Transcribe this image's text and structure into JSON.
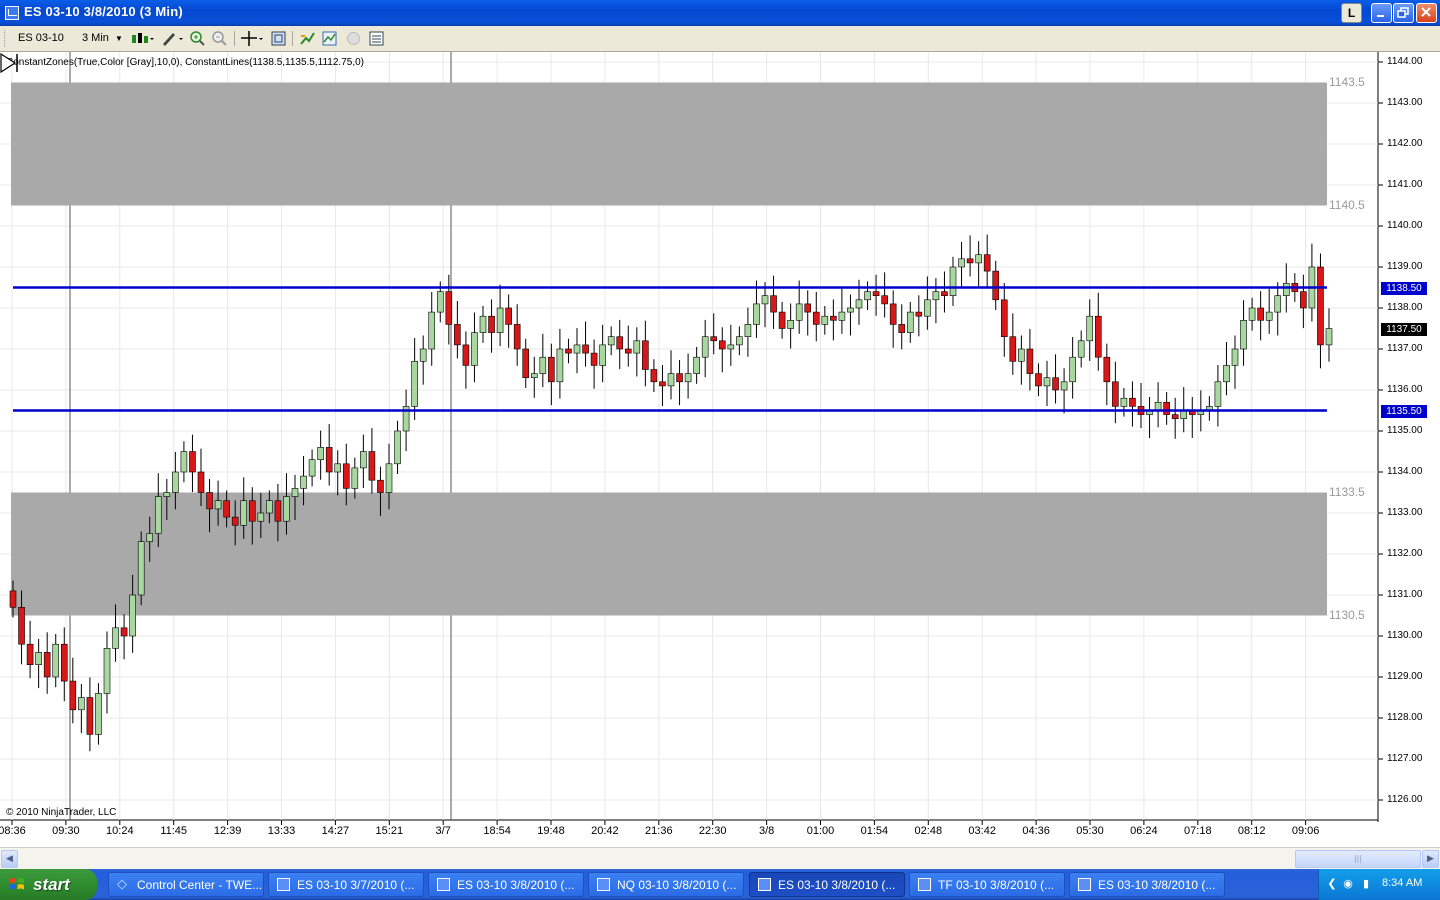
{
  "window": {
    "title": "ES 03-10  3/8/2010 (3 Min)",
    "buttons": {
      "link": "L",
      "minimize": "_",
      "maximize": "□",
      "close": "×"
    }
  },
  "toolbar": {
    "instrument": "ES 03-10",
    "interval": "3 Min",
    "icons": [
      "bar-style-icon",
      "drawing-tools-icon",
      "zoom-in-icon",
      "zoom-out-icon",
      "crosshair-icon",
      "data-box-icon",
      "strategies-icon",
      "indicators-icon",
      "chart-trader-icon",
      "properties-icon"
    ]
  },
  "chart": {
    "indicator_label": "ConstantZones(True,Color [Gray],10,0), ConstantLines(1138.5,1135.5,1112.75,0)",
    "copyright": "© 2010 NinjaTrader, LLC",
    "zone_labels": [
      "1143.5",
      "1140.5",
      "1133.5",
      "1130.5"
    ],
    "price_boxes": [
      {
        "label": "1138.50",
        "color": "#0000cc"
      },
      {
        "label": "1137.50",
        "color": "#000000"
      },
      {
        "label": "1135.50",
        "color": "#0000cc"
      }
    ],
    "colors": {
      "up_bar": "#a8d8a0",
      "down_bar": "#d81818",
      "zone": "#a9a9a9",
      "line": "#0000cc"
    }
  },
  "chart_data": {
    "type": "candlestick",
    "instrument": "ES 03-10",
    "interval": "3 Min",
    "y_axis": {
      "range": [
        1126.0,
        1144.0
      ],
      "ticks": [
        "1144.00",
        "1143.00",
        "1142.00",
        "1141.00",
        "1140.00",
        "1139.00",
        "1138.00",
        "1137.00",
        "1136.00",
        "1135.00",
        "1134.00",
        "1133.00",
        "1132.00",
        "1131.00",
        "1130.00",
        "1129.00",
        "1128.00",
        "1127.00",
        "1126.00"
      ]
    },
    "x_axis": {
      "ticks": [
        "08:36",
        "09:30",
        "10:24",
        "11:45",
        "12:39",
        "13:33",
        "14:27",
        "15:21",
        "3/7",
        "18:54",
        "19:48",
        "20:42",
        "21:36",
        "22:30",
        "3/8",
        "01:00",
        "01:54",
        "02:48",
        "03:42",
        "04:36",
        "05:30",
        "06:24",
        "07:18",
        "08:12",
        "09:06"
      ]
    },
    "zones": [
      {
        "from": 1140.5,
        "to": 1143.5,
        "color": "Gray"
      },
      {
        "from": 1130.5,
        "to": 1133.5,
        "color": "Gray"
      }
    ],
    "constant_lines": [
      1138.5,
      1135.5
    ],
    "last_price": 1137.5,
    "grid": true,
    "closes": [
      1130.7,
      1129.8,
      1129.3,
      1129.6,
      1129.0,
      1129.8,
      1128.9,
      1128.2,
      1128.5,
      1127.6,
      1128.6,
      1129.7,
      1130.2,
      1130.0,
      1131.0,
      1132.3,
      1132.5,
      1133.4,
      1133.5,
      1134.0,
      1134.5,
      1134.0,
      1133.5,
      1133.1,
      1133.3,
      1132.9,
      1132.7,
      1133.3,
      1132.8,
      1133.0,
      1133.3,
      1132.8,
      1133.4,
      1133.6,
      1133.9,
      1134.3,
      1134.6,
      1134.0,
      1134.2,
      1133.6,
      1134.1,
      1134.5,
      1133.8,
      1133.5,
      1134.2,
      1135.0,
      1135.6,
      1136.7,
      1137.0,
      1137.9,
      1138.4,
      1137.6,
      1137.1,
      1136.6,
      1137.4,
      1137.8,
      1137.4,
      1138.0,
      1137.6,
      1137.0,
      1136.3,
      1136.4,
      1136.8,
      1136.2,
      1137.0,
      1136.9,
      1137.1,
      1136.9,
      1136.6,
      1137.1,
      1137.3,
      1137.0,
      1136.9,
      1137.2,
      1136.5,
      1136.2,
      1136.1,
      1136.4,
      1136.2,
      1136.4,
      1136.8,
      1137.3,
      1137.2,
      1137.0,
      1137.1,
      1137.3,
      1137.6,
      1138.1,
      1138.3,
      1137.9,
      1137.5,
      1137.7,
      1138.1,
      1137.9,
      1137.6,
      1137.8,
      1137.7,
      1137.9,
      1138.0,
      1138.2,
      1138.4,
      1138.3,
      1138.1,
      1137.6,
      1137.4,
      1137.9,
      1137.8,
      1138.2,
      1138.4,
      1138.3,
      1139.0,
      1139.2,
      1139.1,
      1139.3,
      1138.9,
      1138.2,
      1137.3,
      1136.7,
      1137.0,
      1136.4,
      1136.1,
      1136.3,
      1136.0,
      1136.2,
      1136.8,
      1137.2,
      1137.8,
      1136.8,
      1136.2,
      1135.6,
      1135.8,
      1135.6,
      1135.4,
      1135.5,
      1135.7,
      1135.4,
      1135.3,
      1135.5,
      1135.4,
      1135.5,
      1135.6,
      1136.2,
      1136.6,
      1137.0,
      1137.7,
      1138.0,
      1137.7,
      1137.9,
      1138.3,
      1138.6,
      1138.4,
      1138.0,
      1139.0,
      1137.1,
      1137.5
    ]
  }
}
